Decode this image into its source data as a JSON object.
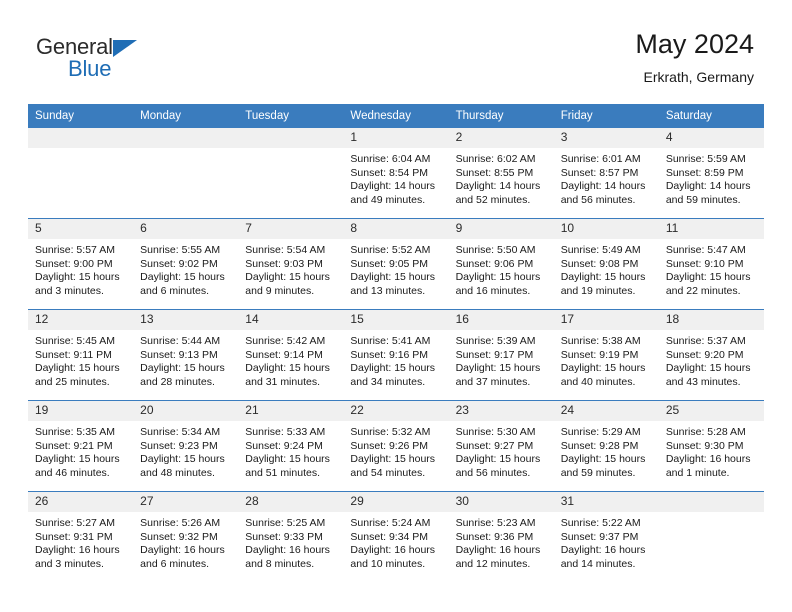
{
  "brand": {
    "line1": "General",
    "line2": "Blue",
    "triangle_color": "#1f6db5"
  },
  "header": {
    "title": "May 2024",
    "subtitle": "Erkrath, Germany"
  },
  "theme": {
    "header_row_bg": "#3a7cbe",
    "daynum_bg": "#f0f0f0",
    "grid_line": "#3a7cbe",
    "text": "#1a1a1a"
  },
  "labels": {
    "sunrise_prefix": "Sunrise:",
    "sunset_prefix": "Sunset:",
    "daylight_prefix": "Daylight:"
  },
  "weekdays": [
    "Sunday",
    "Monday",
    "Tuesday",
    "Wednesday",
    "Thursday",
    "Friday",
    "Saturday"
  ],
  "weeks": [
    [
      {
        "day": "",
        "empty": true
      },
      {
        "day": "",
        "empty": true
      },
      {
        "day": "",
        "empty": true
      },
      {
        "day": "1",
        "sunrise": "Sunrise: 6:04 AM",
        "sunset": "Sunset: 8:54 PM",
        "daylight": "Daylight: 14 hours and 49 minutes."
      },
      {
        "day": "2",
        "sunrise": "Sunrise: 6:02 AM",
        "sunset": "Sunset: 8:55 PM",
        "daylight": "Daylight: 14 hours and 52 minutes."
      },
      {
        "day": "3",
        "sunrise": "Sunrise: 6:01 AM",
        "sunset": "Sunset: 8:57 PM",
        "daylight": "Daylight: 14 hours and 56 minutes."
      },
      {
        "day": "4",
        "sunrise": "Sunrise: 5:59 AM",
        "sunset": "Sunset: 8:59 PM",
        "daylight": "Daylight: 14 hours and 59 minutes."
      }
    ],
    [
      {
        "day": "5",
        "sunrise": "Sunrise: 5:57 AM",
        "sunset": "Sunset: 9:00 PM",
        "daylight": "Daylight: 15 hours and 3 minutes."
      },
      {
        "day": "6",
        "sunrise": "Sunrise: 5:55 AM",
        "sunset": "Sunset: 9:02 PM",
        "daylight": "Daylight: 15 hours and 6 minutes."
      },
      {
        "day": "7",
        "sunrise": "Sunrise: 5:54 AM",
        "sunset": "Sunset: 9:03 PM",
        "daylight": "Daylight: 15 hours and 9 minutes."
      },
      {
        "day": "8",
        "sunrise": "Sunrise: 5:52 AM",
        "sunset": "Sunset: 9:05 PM",
        "daylight": "Daylight: 15 hours and 13 minutes."
      },
      {
        "day": "9",
        "sunrise": "Sunrise: 5:50 AM",
        "sunset": "Sunset: 9:06 PM",
        "daylight": "Daylight: 15 hours and 16 minutes."
      },
      {
        "day": "10",
        "sunrise": "Sunrise: 5:49 AM",
        "sunset": "Sunset: 9:08 PM",
        "daylight": "Daylight: 15 hours and 19 minutes."
      },
      {
        "day": "11",
        "sunrise": "Sunrise: 5:47 AM",
        "sunset": "Sunset: 9:10 PM",
        "daylight": "Daylight: 15 hours and 22 minutes."
      }
    ],
    [
      {
        "day": "12",
        "sunrise": "Sunrise: 5:45 AM",
        "sunset": "Sunset: 9:11 PM",
        "daylight": "Daylight: 15 hours and 25 minutes."
      },
      {
        "day": "13",
        "sunrise": "Sunrise: 5:44 AM",
        "sunset": "Sunset: 9:13 PM",
        "daylight": "Daylight: 15 hours and 28 minutes."
      },
      {
        "day": "14",
        "sunrise": "Sunrise: 5:42 AM",
        "sunset": "Sunset: 9:14 PM",
        "daylight": "Daylight: 15 hours and 31 minutes."
      },
      {
        "day": "15",
        "sunrise": "Sunrise: 5:41 AM",
        "sunset": "Sunset: 9:16 PM",
        "daylight": "Daylight: 15 hours and 34 minutes."
      },
      {
        "day": "16",
        "sunrise": "Sunrise: 5:39 AM",
        "sunset": "Sunset: 9:17 PM",
        "daylight": "Daylight: 15 hours and 37 minutes."
      },
      {
        "day": "17",
        "sunrise": "Sunrise: 5:38 AM",
        "sunset": "Sunset: 9:19 PM",
        "daylight": "Daylight: 15 hours and 40 minutes."
      },
      {
        "day": "18",
        "sunrise": "Sunrise: 5:37 AM",
        "sunset": "Sunset: 9:20 PM",
        "daylight": "Daylight: 15 hours and 43 minutes."
      }
    ],
    [
      {
        "day": "19",
        "sunrise": "Sunrise: 5:35 AM",
        "sunset": "Sunset: 9:21 PM",
        "daylight": "Daylight: 15 hours and 46 minutes."
      },
      {
        "day": "20",
        "sunrise": "Sunrise: 5:34 AM",
        "sunset": "Sunset: 9:23 PM",
        "daylight": "Daylight: 15 hours and 48 minutes."
      },
      {
        "day": "21",
        "sunrise": "Sunrise: 5:33 AM",
        "sunset": "Sunset: 9:24 PM",
        "daylight": "Daylight: 15 hours and 51 minutes."
      },
      {
        "day": "22",
        "sunrise": "Sunrise: 5:32 AM",
        "sunset": "Sunset: 9:26 PM",
        "daylight": "Daylight: 15 hours and 54 minutes."
      },
      {
        "day": "23",
        "sunrise": "Sunrise: 5:30 AM",
        "sunset": "Sunset: 9:27 PM",
        "daylight": "Daylight: 15 hours and 56 minutes."
      },
      {
        "day": "24",
        "sunrise": "Sunrise: 5:29 AM",
        "sunset": "Sunset: 9:28 PM",
        "daylight": "Daylight: 15 hours and 59 minutes."
      },
      {
        "day": "25",
        "sunrise": "Sunrise: 5:28 AM",
        "sunset": "Sunset: 9:30 PM",
        "daylight": "Daylight: 16 hours and 1 minute."
      }
    ],
    [
      {
        "day": "26",
        "sunrise": "Sunrise: 5:27 AM",
        "sunset": "Sunset: 9:31 PM",
        "daylight": "Daylight: 16 hours and 3 minutes."
      },
      {
        "day": "27",
        "sunrise": "Sunrise: 5:26 AM",
        "sunset": "Sunset: 9:32 PM",
        "daylight": "Daylight: 16 hours and 6 minutes."
      },
      {
        "day": "28",
        "sunrise": "Sunrise: 5:25 AM",
        "sunset": "Sunset: 9:33 PM",
        "daylight": "Daylight: 16 hours and 8 minutes."
      },
      {
        "day": "29",
        "sunrise": "Sunrise: 5:24 AM",
        "sunset": "Sunset: 9:34 PM",
        "daylight": "Daylight: 16 hours and 10 minutes."
      },
      {
        "day": "30",
        "sunrise": "Sunrise: 5:23 AM",
        "sunset": "Sunset: 9:36 PM",
        "daylight": "Daylight: 16 hours and 12 minutes."
      },
      {
        "day": "31",
        "sunrise": "Sunrise: 5:22 AM",
        "sunset": "Sunset: 9:37 PM",
        "daylight": "Daylight: 16 hours and 14 minutes."
      },
      {
        "day": "",
        "empty": true
      }
    ]
  ]
}
